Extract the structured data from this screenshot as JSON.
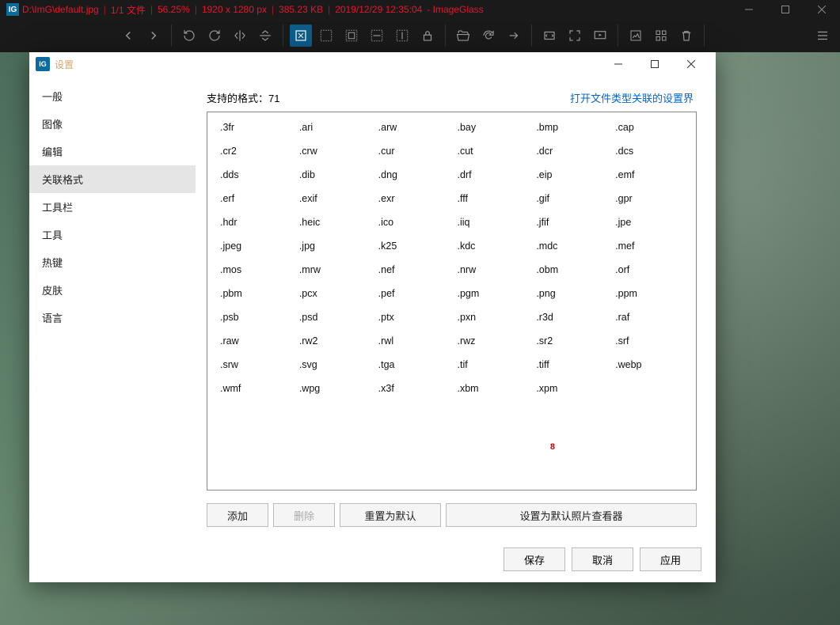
{
  "main": {
    "path": "D:\\ImG\\default.jpg",
    "file_count": "1/1 文件",
    "zoom": "56.25%",
    "dims": "1920 x 1280 px",
    "size": "385.23 KB",
    "datetime": "2019/12/29 12:35:04",
    "app_name": "- ImageGlass",
    "separator": "|"
  },
  "settings": {
    "title": "设置",
    "sidebar": {
      "items": [
        {
          "label": "一般"
        },
        {
          "label": "图像"
        },
        {
          "label": "编辑"
        },
        {
          "label": "关联格式"
        },
        {
          "label": "工具栏"
        },
        {
          "label": "工具"
        },
        {
          "label": "热键"
        },
        {
          "label": "皮肤"
        },
        {
          "label": "语言"
        }
      ],
      "selected_index": 3
    },
    "content": {
      "supported_label": "支持的格式：",
      "count": "71",
      "link_text": "打开文件类型关联的设置界",
      "formats": [
        ".3fr",
        ".ari",
        ".arw",
        ".bay",
        ".bmp",
        ".cap",
        ".cr2",
        ".crw",
        ".cur",
        ".cut",
        ".dcr",
        ".dcs",
        ".dds",
        ".dib",
        ".dng",
        ".drf",
        ".eip",
        ".emf",
        ".erf",
        ".exif",
        ".exr",
        ".fff",
        ".gif",
        ".gpr",
        ".hdr",
        ".heic",
        ".ico",
        ".iiq",
        ".jfif",
        ".jpe",
        ".jpeg",
        ".jpg",
        ".k25",
        ".kdc",
        ".mdc",
        ".mef",
        ".mos",
        ".mrw",
        ".nef",
        ".nrw",
        ".obm",
        ".orf",
        ".pbm",
        ".pcx",
        ".pef",
        ".pgm",
        ".png",
        ".ppm",
        ".psb",
        ".psd",
        ".ptx",
        ".pxn",
        ".r3d",
        ".raf",
        ".raw",
        ".rw2",
        ".rwl",
        ".rwz",
        ".sr2",
        ".srf",
        ".srw",
        ".svg",
        ".tga",
        ".tif",
        ".tiff",
        ".webp",
        ".wmf",
        ".wpg",
        ".x3f",
        ".xbm",
        ".xpm"
      ],
      "actions": {
        "add": "添加",
        "delete": "删除",
        "reset": "重置为默认",
        "set_default": "设置为默认照片查看器"
      }
    },
    "footer": {
      "save": "保存",
      "cancel": "取消",
      "apply": "应用"
    }
  }
}
